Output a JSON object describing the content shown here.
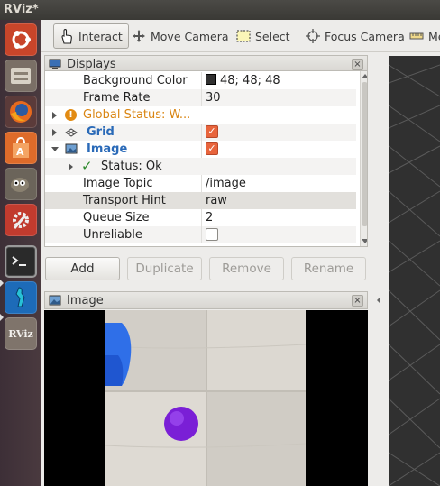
{
  "window": {
    "title": "RViz*"
  },
  "toolbar": {
    "interact": "Interact",
    "move_camera": "Move Camera",
    "select": "Select",
    "focus_camera": "Focus Camera",
    "measure": "Me"
  },
  "displays": {
    "title": "Displays",
    "close": "×",
    "rows": {
      "background_color": {
        "key": "Background Color",
        "value": "48; 48; 48"
      },
      "frame_rate": {
        "key": "Frame Rate",
        "value": "30"
      },
      "global_status": {
        "key": "Global Status: W...",
        "icon_text": "!"
      },
      "grid": {
        "key": "Grid",
        "check": "✓"
      },
      "image": {
        "key": "Image",
        "check": "✓"
      },
      "status_ok": {
        "key": "Status: Ok",
        "mark": "✓"
      },
      "image_topic": {
        "key": "Image Topic",
        "value": "/image"
      },
      "transport_hint": {
        "key": "Transport Hint",
        "value": "raw"
      },
      "queue_size": {
        "key": "Queue Size",
        "value": "2"
      },
      "unreliable": {
        "key": "Unreliable"
      }
    },
    "buttons": {
      "add": "Add",
      "duplicate": "Duplicate",
      "remove": "Remove",
      "rename": "Rename"
    }
  },
  "image_panel": {
    "title": "Image",
    "close": "×"
  },
  "launcher": {
    "rviz_label": "RViz"
  },
  "colors": {
    "background_swatch": "#303030",
    "accent_orange": "#e8643c",
    "warning": "#e28b13",
    "link_blue": "#2a6ab8",
    "ok_green": "#2d8a2d"
  }
}
